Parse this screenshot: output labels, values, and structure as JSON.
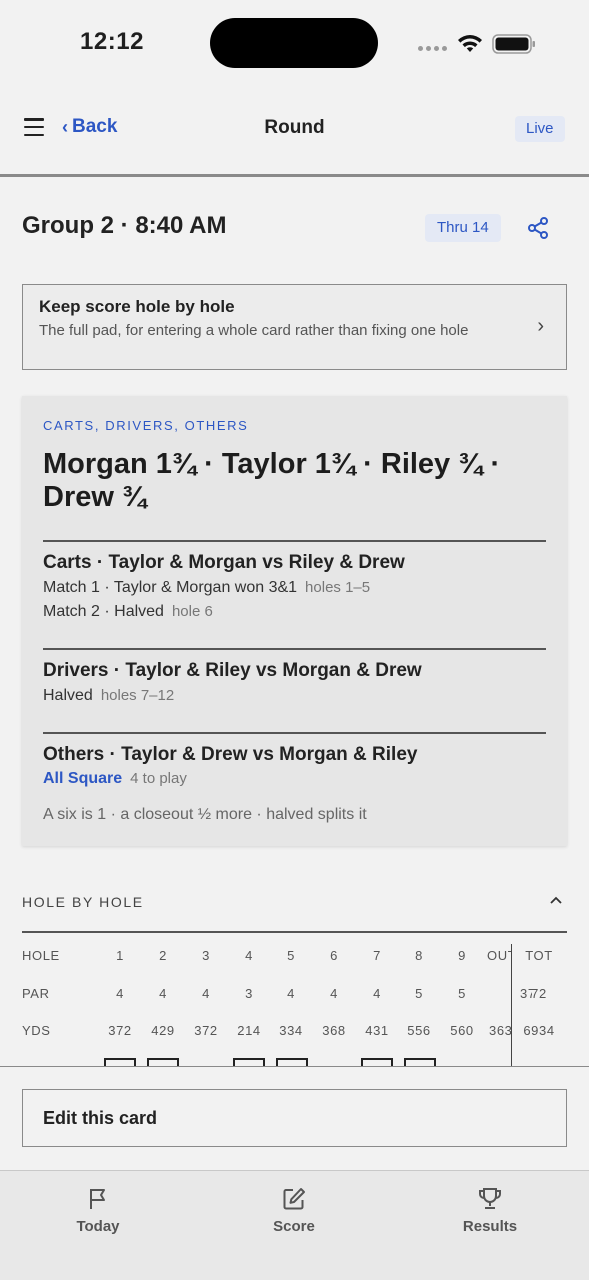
{
  "status": {
    "time": "12:12"
  },
  "header": {
    "back_label": "Back",
    "title": "Round",
    "live_badge": "Live"
  },
  "group": {
    "title": "Group 2 · 8:40 AM",
    "thru": "Thru 14"
  },
  "keep_score": {
    "title": "Keep score hole by hole",
    "subtitle": "The full pad, for entering a whole card rather than fixing one hole"
  },
  "summary": {
    "eyebrow": "CARTS, DRIVERS, OTHERS",
    "headline": "Morgan 1¾ · Taylor 1¾ · Riley ¾ · Drew ¾",
    "matches": [
      {
        "title": "Carts · Taylor & Morgan  vs  Riley & Drew",
        "lines": [
          {
            "text": "Match 1 · Taylor & Morgan won 3&1",
            "detail": "holes 1–5"
          },
          {
            "text": "Match 2 · Halved",
            "detail": "hole 6"
          }
        ]
      },
      {
        "title": "Drivers · Taylor & Riley  vs  Morgan & Drew",
        "lines": [
          {
            "text": "Halved",
            "detail": "holes 7–12"
          }
        ]
      },
      {
        "title": "Others · Taylor & Drew  vs  Morgan & Riley",
        "lines": [
          {
            "text": "All Square",
            "detail": "4 to play"
          }
        ]
      }
    ],
    "rule_note": "A six is 1 · a closeout ½ more · halved splits it"
  },
  "hole_by_hole": {
    "title": "HOLE BY HOLE",
    "rows": [
      {
        "label": "HOLE",
        "cells": [
          "1",
          "2",
          "3",
          "4",
          "5",
          "6",
          "7",
          "8",
          "9",
          "OUT",
          "TOT"
        ]
      },
      {
        "label": "PAR",
        "cells": [
          "4",
          "4",
          "4",
          "3",
          "4",
          "4",
          "4",
          "5",
          "5",
          "37",
          "72"
        ]
      },
      {
        "label": "YDS",
        "cells": [
          "372",
          "429",
          "372",
          "214",
          "334",
          "368",
          "431",
          "556",
          "560",
          "3636",
          "6934"
        ]
      }
    ]
  },
  "actions": {
    "edit_card": "Edit this card"
  },
  "tabs": [
    {
      "label": "Today",
      "icon": "flag-icon"
    },
    {
      "label": "Score",
      "icon": "edit-icon"
    },
    {
      "label": "Results",
      "icon": "trophy-icon"
    }
  ]
}
